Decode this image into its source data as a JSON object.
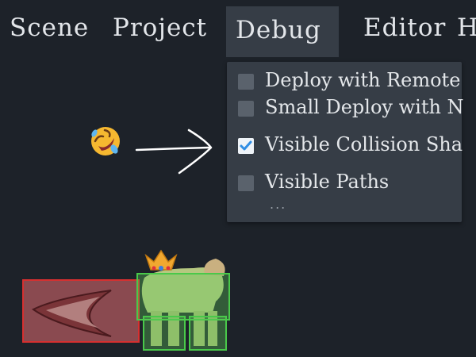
{
  "menubar": {
    "items": [
      {
        "label": "Scene"
      },
      {
        "label": "Project"
      },
      {
        "label": "Debug"
      },
      {
        "label": "Editor"
      },
      {
        "label": "H"
      }
    ]
  },
  "debug_menu": {
    "items": [
      {
        "label": "Deploy with Remote",
        "checked": false
      },
      {
        "label": "Small Deploy with N",
        "checked": false
      },
      {
        "label": "Visible Collision Sha",
        "checked": true
      },
      {
        "label": "Visible Paths",
        "checked": false
      }
    ],
    "more": "..."
  },
  "colors": {
    "background": "#1d2229",
    "menu_panel": "#363d46",
    "checkbox_unchecked": "#5a626c",
    "checkmark": "#2f8de4",
    "collision_green": "#49c94a",
    "collision_red": "#d63030"
  },
  "icons": {
    "emoji": "rolling-on-floor-laughing-icon",
    "arrow": "arrow-right-icon",
    "crown": "crown-icon"
  }
}
